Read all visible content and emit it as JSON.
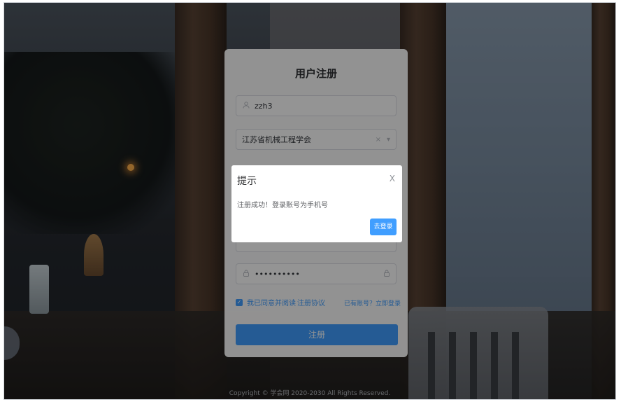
{
  "form": {
    "title": "用户注册",
    "username_value": "zzh3",
    "organization_value": "江苏省机械工程学会",
    "organization_clear": "×",
    "organization_arrow": "▾",
    "password_value": "••••••••••",
    "agree_text": "我已同意并阅读",
    "agree_link": "注册协议",
    "login_link": "已有账号？立即登录",
    "submit_label": "注册"
  },
  "dialog": {
    "title": "提示",
    "close": "X",
    "message": "注册成功！登录账号为手机号",
    "button": "去登录"
  },
  "footer": {
    "copyright": "Copyright © 学会网 2020-2030 All Rights Reserved."
  },
  "icons": {
    "user": "user-icon",
    "lock": "lock-icon",
    "check": "checkbox-checked-icon"
  },
  "colors": {
    "accent": "#409eff",
    "overlay": "rgba(0,0,0,0.42)"
  }
}
